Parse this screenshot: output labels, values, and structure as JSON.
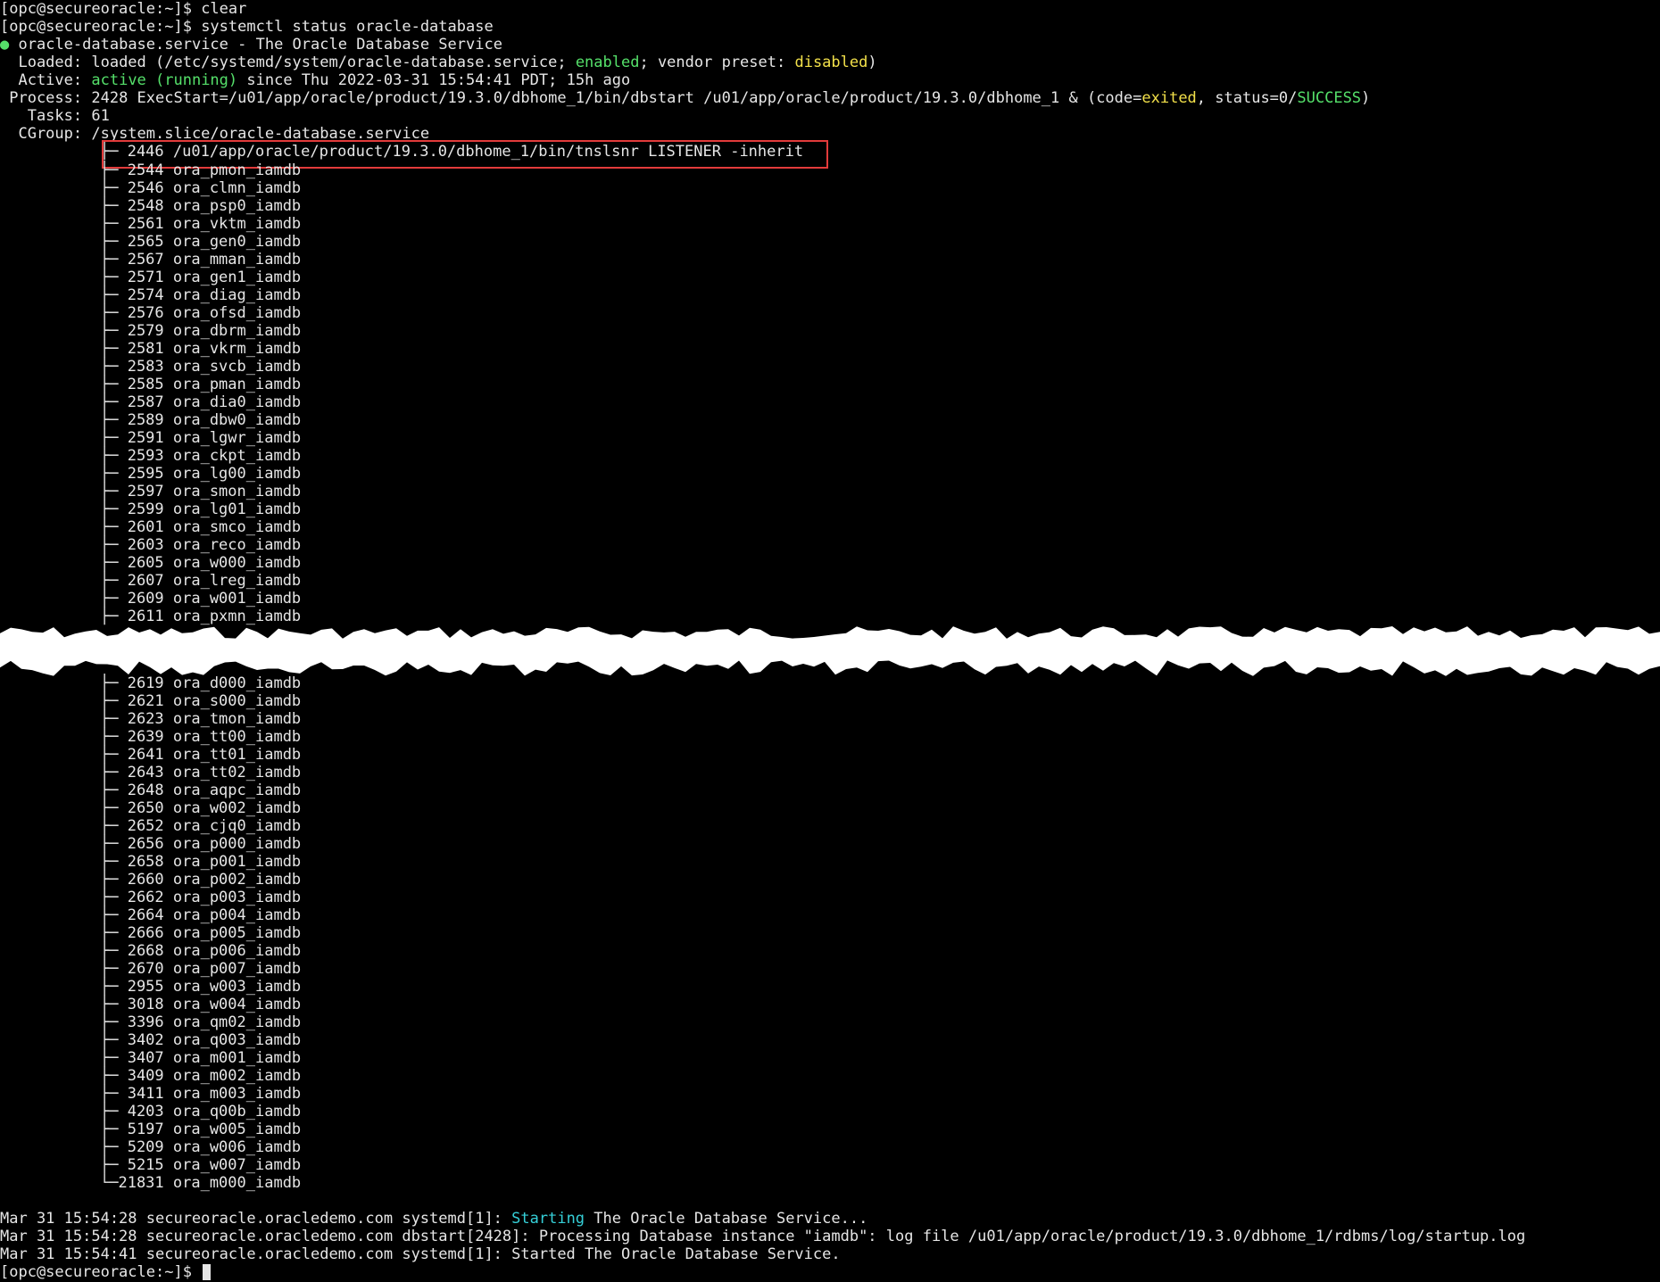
{
  "prompt": "[opc@secureoracle:~]$",
  "cmd_clear": "clear",
  "cmd_status": "systemctl status oracle-database",
  "service_header": "oracle-database.service - The Oracle Database Service",
  "loaded": {
    "label": "  Loaded:",
    "pre": " loaded (/etc/systemd/system/oracle-database.service; ",
    "enabled": "enabled",
    "mid": "; vendor preset: ",
    "disabled": "disabled",
    "post": ")"
  },
  "active": {
    "label": "  Active:",
    "state": "active (running)",
    "rest": " since Thu 2022-03-31 15:54:41 PDT; 15h ago"
  },
  "process": {
    "label": " Process:",
    "pre": " 2428 ExecStart=/u01/app/oracle/product/19.3.0/dbhome_1/bin/dbstart /u01/app/oracle/product/19.3.0/dbhome_1 & (code=",
    "exited": "exited",
    "mid": ", status=0/",
    "success": "SUCCESS",
    "post": ")"
  },
  "tasks": {
    "label": "   Tasks:",
    "value": " 61"
  },
  "cgroup": {
    "label": "  CGroup:",
    "value": " /system.slice/oracle-database.service"
  },
  "highlighted_process": "├─ 2446 /u01/app/oracle/product/19.3.0/dbhome_1/bin/tnslsnr LISTENER -inherit",
  "tree_top": [
    "├─ 2544 ora_pmon_iamdb",
    "├─ 2546 ora_clmn_iamdb",
    "├─ 2548 ora_psp0_iamdb",
    "├─ 2561 ora_vktm_iamdb",
    "├─ 2565 ora_gen0_iamdb",
    "├─ 2567 ora_mman_iamdb",
    "├─ 2571 ora_gen1_iamdb",
    "├─ 2574 ora_diag_iamdb",
    "├─ 2576 ora_ofsd_iamdb",
    "├─ 2579 ora_dbrm_iamdb",
    "├─ 2581 ora_vkrm_iamdb",
    "├─ 2583 ora_svcb_iamdb",
    "├─ 2585 ora_pman_iamdb",
    "├─ 2587 ora_dia0_iamdb",
    "├─ 2589 ora_dbw0_iamdb",
    "├─ 2591 ora_lgwr_iamdb",
    "├─ 2593 ora_ckpt_iamdb",
    "├─ 2595 ora_lg00_iamdb",
    "├─ 2597 ora_smon_iamdb",
    "├─ 2599 ora_lg01_iamdb",
    "├─ 2601 ora_smco_iamdb",
    "├─ 2603 ora_reco_iamdb",
    "├─ 2605 ora_w000_iamdb",
    "├─ 2607 ora_lreg_iamdb",
    "├─ 2609 ora_w001_iamdb",
    "├─ 2611 ora_pxmn_iamdb"
  ],
  "tree_bottom": [
    "├─ 2619 ora_d000_iamdb",
    "├─ 2621 ora_s000_iamdb",
    "├─ 2623 ora_tmon_iamdb",
    "├─ 2639 ora_tt00_iamdb",
    "├─ 2641 ora_tt01_iamdb",
    "├─ 2643 ora_tt02_iamdb",
    "├─ 2648 ora_aqpc_iamdb",
    "├─ 2650 ora_w002_iamdb",
    "├─ 2652 ora_cjq0_iamdb",
    "├─ 2656 ora_p000_iamdb",
    "├─ 2658 ora_p001_iamdb",
    "├─ 2660 ora_p002_iamdb",
    "├─ 2662 ora_p003_iamdb",
    "├─ 2664 ora_p004_iamdb",
    "├─ 2666 ora_p005_iamdb",
    "├─ 2668 ora_p006_iamdb",
    "├─ 2670 ora_p007_iamdb",
    "├─ 2955 ora_w003_iamdb",
    "├─ 3018 ora_w004_iamdb",
    "├─ 3396 ora_qm02_iamdb",
    "├─ 3402 ora_q003_iamdb",
    "├─ 3407 ora_m001_iamdb",
    "├─ 3409 ora_m002_iamdb",
    "├─ 3411 ora_m003_iamdb",
    "├─ 4203 ora_q00b_iamdb",
    "├─ 5197 ora_w005_iamdb",
    "├─ 5209 ora_w006_iamdb",
    "├─ 5215 ora_w007_iamdb",
    "└─21831 ora_m000_iamdb"
  ],
  "log": {
    "l1_pre": "Mar 31 15:54:28 secureoracle.oracledemo.com systemd[1]: ",
    "l1_starting": "Starting",
    "l1_post": " The Oracle Database Service...",
    "l2": "Mar 31 15:54:28 secureoracle.oracledemo.com dbstart[2428]: Processing Database instance \"iamdb\": log file /u01/app/oracle/product/19.3.0/dbhome_1/rdbms/log/startup.log",
    "l3": "Mar 31 15:54:41 secureoracle.oracledemo.com systemd[1]: Started The Oracle Database Service."
  },
  "colors": {
    "background": "#000000",
    "text": "#e6e6e6",
    "green": "#55e06a",
    "cyan": "#35d0d8",
    "yellow": "#f2e04a",
    "highlight_border": "#e23b3b"
  }
}
